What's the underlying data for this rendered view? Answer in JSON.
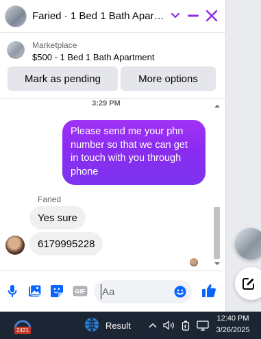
{
  "header": {
    "title": "Faried · 1 Bed 1 Bath Apartment",
    "accent": "#8a2be2"
  },
  "marketplace": {
    "source": "Marketplace",
    "listing": "$500 - 1 Bed 1 Bath Apartment",
    "mark_pending_label": "Mark as pending",
    "more_options_label": "More options"
  },
  "messages": {
    "timestamp": "3:29 PM",
    "outgoing": [
      {
        "text": "Please send me your phn number so that we can get in touch with you through phone"
      }
    ],
    "sender_name": "Faried",
    "incoming": [
      {
        "text": "Yes sure"
      },
      {
        "text": "6179995228"
      }
    ]
  },
  "composer": {
    "placeholder": "Aa",
    "icons": [
      "microphone-icon",
      "photo-icon",
      "sticker-icon",
      "gif-icon",
      "emoji-icon",
      "thumbs-up-icon"
    ]
  },
  "taskbar": {
    "badge": "2421",
    "app_label": "Result",
    "time": "12:40 PM",
    "date": "3/26/2025"
  }
}
